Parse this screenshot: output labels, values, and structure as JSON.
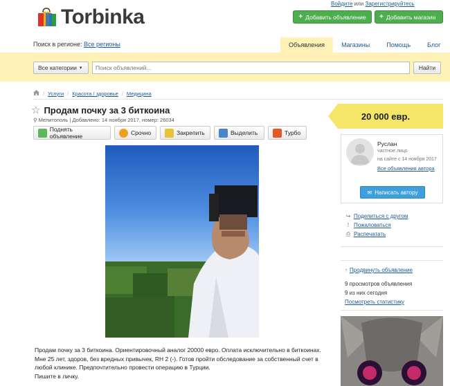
{
  "header": {
    "logo_text": "Torbinka",
    "auth_login": "Войдите",
    "auth_or": "или",
    "auth_register": "Зарегистрируйтесь",
    "add_ad_button": "Добавить объявление",
    "add_shop_button": "Добавить магазин"
  },
  "region": {
    "label": "Поиск в регионе:",
    "value": "Все регионы"
  },
  "tabs": [
    {
      "label": "Объявления"
    },
    {
      "label": "Магазины"
    },
    {
      "label": "Помощь"
    },
    {
      "label": "Блог"
    }
  ],
  "search": {
    "category": "Все категории",
    "placeholder": "Поиск объявлений...",
    "button": "Найти"
  },
  "breadcrumb": [
    "Услуги",
    "Красота / здоровье",
    "Медицина"
  ],
  "listing": {
    "title": "Продам почку за 3 биткоина",
    "meta": "Мелитополь | Добавлено: 14 ноября 2017, номер: 26034",
    "actions": [
      {
        "label": "Поднять объявление",
        "color": "#5cb85c"
      },
      {
        "label": "Срочно",
        "color": "#f0a020"
      },
      {
        "label": "Закрепить",
        "color": "#e8c43a"
      },
      {
        "label": "Выделить",
        "color": "#4a86c8"
      },
      {
        "label": "Турбо",
        "color": "#e05a2a"
      }
    ],
    "description": [
      "Продам почку за 3 биткоина. Ориентировочный аналог 20000 евро. Оплата исключительно в биткоинах.",
      "Мне 25 лет, здоров, без вредных привычек, RH 2 (-). Готов пройти обследование за собственный счет в любой клинике. Предпочтительно провести операцию в Турции.",
      "Пишите в личку."
    ]
  },
  "sidebar": {
    "price": "20 000 евр.",
    "seller_name": "Руслан",
    "seller_type": "частное лицо",
    "seller_since": "на сайте с 14 ноября 2017",
    "seller_all": "Все объявления автора",
    "write_button": "Написать автору",
    "links": [
      {
        "label": "Поделиться с другом",
        "icon": "share-icon"
      },
      {
        "label": "Пожаловаться",
        "icon": "alert-icon"
      },
      {
        "label": "Распечатать",
        "icon": "print-icon"
      }
    ],
    "promote": "Продвинуть объявление",
    "views_total": "9 просмотров объявления",
    "views_today": "9 из них сегодня",
    "stats_link": "Посмотреть статистику"
  },
  "colors": {
    "accent_yellow": "#fff2b6",
    "price_yellow": "#f5e66a",
    "green_button": "#4cae4c",
    "blue_button": "#3d9fde",
    "link": "#1a5a96"
  }
}
